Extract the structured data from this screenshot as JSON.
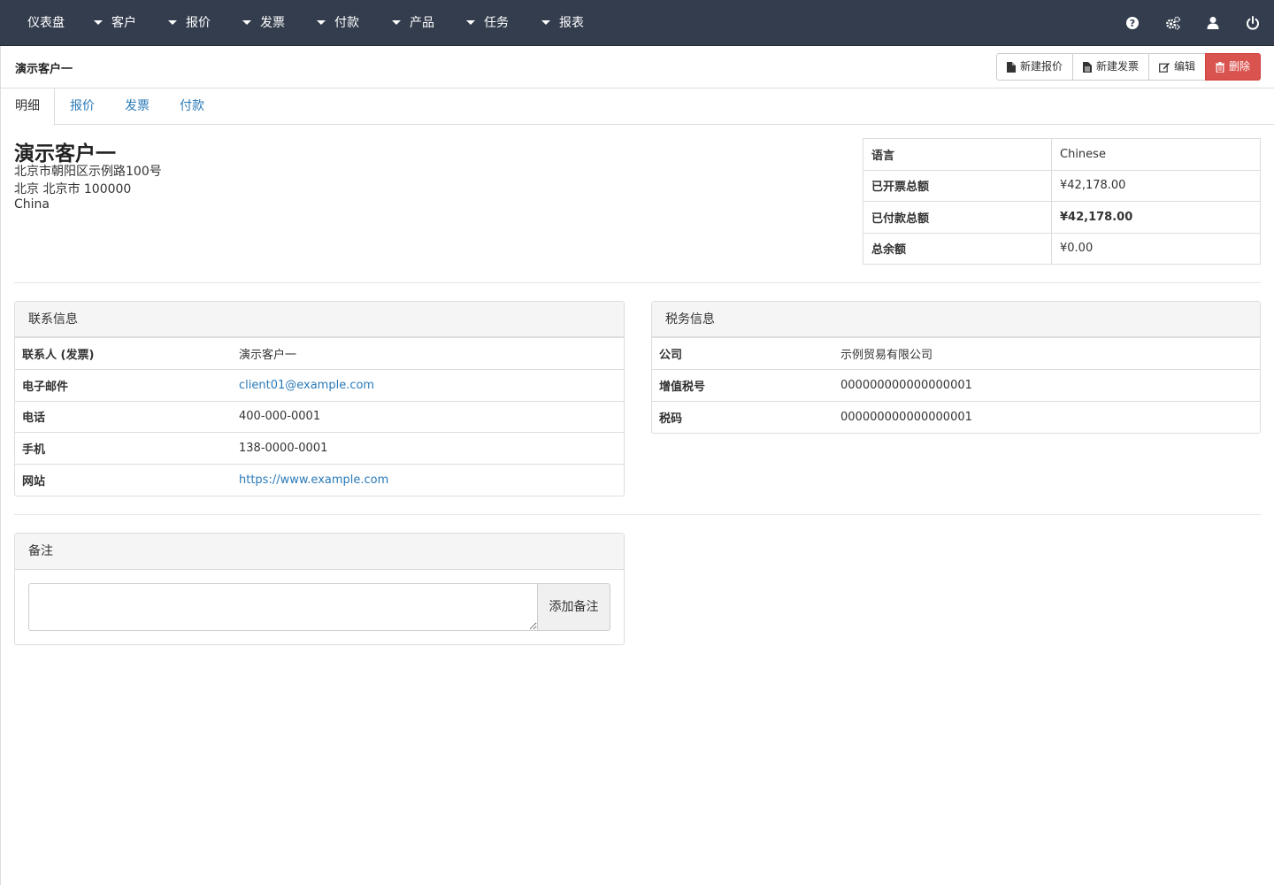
{
  "nav": {
    "items": [
      {
        "label": "仪表盘"
      },
      {
        "label": "客户"
      },
      {
        "label": "报价"
      },
      {
        "label": "发票"
      },
      {
        "label": "付款"
      },
      {
        "label": "产品"
      },
      {
        "label": "任务"
      },
      {
        "label": "报表"
      }
    ],
    "icons": [
      "help-icon",
      "settings-icon",
      "user-icon",
      "power-icon"
    ]
  },
  "header": {
    "title": "演示客户一",
    "buttons": {
      "new_quote": "新建报价",
      "new_invoice": "新建发票",
      "edit": "编辑",
      "delete": "删除"
    }
  },
  "tabs": [
    {
      "label": "明细"
    },
    {
      "label": "报价"
    },
    {
      "label": "发票"
    },
    {
      "label": "付款"
    }
  ],
  "client": {
    "name": "演示客户一",
    "address_line1": "北京市朝阳区示例路100号",
    "address_line2": "北京 北京市 100000",
    "country": "China"
  },
  "summary": {
    "language_label": "语言",
    "language_value": "Chinese",
    "invoiced_label": "已开票总额",
    "invoiced_value": "¥42,178.00",
    "paid_label": "已付款总额",
    "paid_value": "¥42,178.00",
    "balance_label": "总余额",
    "balance_value": "¥0.00"
  },
  "contact": {
    "title": "联系信息",
    "rows": [
      {
        "label": "联系人 (发票)",
        "value": "演示客户一"
      },
      {
        "label": "电子邮件",
        "value": "client01@example.com"
      },
      {
        "label": "电话",
        "value": "400-000-0001"
      },
      {
        "label": "手机",
        "value": "138-0000-0001"
      },
      {
        "label": "网站",
        "value": "https://www.example.com"
      }
    ]
  },
  "tax": {
    "title": "税务信息",
    "rows": [
      {
        "label": "公司",
        "value": "示例贸易有限公司"
      },
      {
        "label": "增值税号",
        "value": "000000000000000001"
      },
      {
        "label": "税码",
        "value": "000000000000000001"
      }
    ]
  },
  "notes": {
    "title": "备注",
    "input_value": "",
    "add_button": "添加备注"
  },
  "colors": {
    "nav_bg": "#333d4d",
    "link": "#2a7ab8",
    "danger": "#d9534f"
  }
}
